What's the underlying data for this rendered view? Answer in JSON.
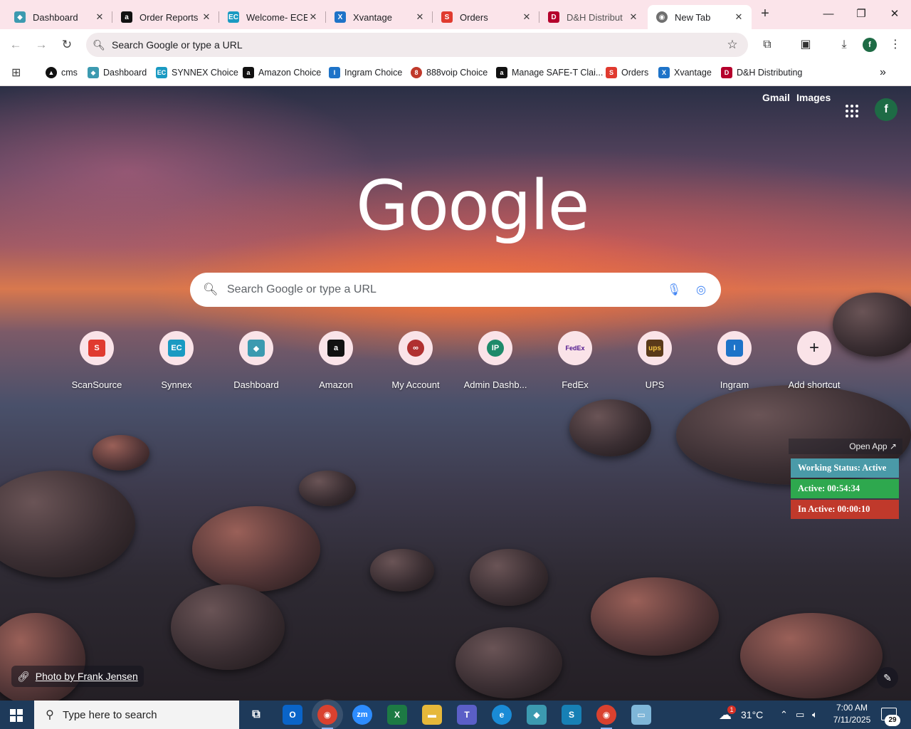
{
  "tabs": [
    {
      "title": "Dashboard",
      "icon": "dashboard-favicon",
      "color": "#3c9ab0"
    },
    {
      "title": "Order Reports",
      "icon": "amazon-favicon",
      "color": "#111111"
    },
    {
      "title": "Welcome- ECE",
      "icon": "ec-favicon",
      "color": "#1a9ac2"
    },
    {
      "title": "Xvantage",
      "icon": "xvantage-favicon",
      "color": "#1e73c8"
    },
    {
      "title": "Orders",
      "icon": "scansource-favicon",
      "color": "#e03a2f"
    },
    {
      "title": "D&H Distribut",
      "icon": "dh-favicon",
      "color": "#b5002c"
    },
    {
      "title": "New Tab",
      "icon": "chrome-favicon",
      "color": "#6f6f6f"
    }
  ],
  "omnibox": {
    "placeholder": "Search Google or type a URL"
  },
  "profile_initial": "f",
  "bookmarks": [
    {
      "label": "cms",
      "icon": "cms-favicon",
      "color": "#111111"
    },
    {
      "label": "Dashboard",
      "icon": "dashboard-favicon",
      "color": "#3c9ab0"
    },
    {
      "label": "SYNNEX Choice",
      "icon": "ec-favicon",
      "color": "#1a9ac2"
    },
    {
      "label": "Amazon Choice",
      "icon": "amazon-favicon",
      "color": "#111111"
    },
    {
      "label": "Ingram Choice",
      "icon": "ingram-favicon",
      "color": "#1e73c8"
    },
    {
      "label": "888voip Choice",
      "icon": "888voip-favicon",
      "color": "#c0392b"
    },
    {
      "label": "Manage SAFE-T Clai...",
      "icon": "amazon-favicon",
      "color": "#111111"
    },
    {
      "label": "Orders",
      "icon": "scansource-favicon",
      "color": "#e03a2f"
    },
    {
      "label": "Xvantage",
      "icon": "xvantage-favicon",
      "color": "#1e73c8"
    },
    {
      "label": "D&H Distributing",
      "icon": "dh-favicon",
      "color": "#b5002c"
    }
  ],
  "google": {
    "links": {
      "gmail": "Gmail",
      "images": "Images"
    },
    "avatar_initial": "f",
    "logo": "Google",
    "search_placeholder": "Search Google or type a URL"
  },
  "shortcuts": [
    {
      "label": "ScanSource",
      "icon": "scansource-icon",
      "glyph": "S",
      "color": "#e03a2f"
    },
    {
      "label": "Synnex",
      "icon": "ec-icon",
      "glyph": "EC",
      "color": "#1a9ac2"
    },
    {
      "label": "Dashboard",
      "icon": "dashboard-icon",
      "glyph": "◆",
      "color": "#3c9ab0"
    },
    {
      "label": "Amazon",
      "icon": "amazon-icon",
      "glyph": "a",
      "color": "#111111"
    },
    {
      "label": "My Account",
      "icon": "my-account-icon",
      "glyph": "∞",
      "color": "#b03030"
    },
    {
      "label": "Admin Dashb...",
      "icon": "ip-icon",
      "glyph": "IP",
      "color": "#1e8a6a"
    },
    {
      "label": "FedEx",
      "icon": "fedex-icon",
      "glyph": "FedEx",
      "color": "#4d148c"
    },
    {
      "label": "UPS",
      "icon": "ups-icon",
      "glyph": "ups",
      "color": "#5a3a1a"
    },
    {
      "label": "Ingram",
      "icon": "ingram-icon",
      "glyph": "I",
      "color": "#1e73c8"
    },
    {
      "label": "Add shortcut",
      "icon": "plus-icon",
      "glyph": "+",
      "color": "#202124"
    }
  ],
  "tracker": {
    "open_app": "Open App ↗",
    "working_status": "Working Status: Active",
    "active": "Active: 00:54:34",
    "inactive": "In Active: 00:00:10",
    "colors": {
      "status": "#4a9aa8",
      "active": "#2ea84e",
      "inactive": "#c0392b"
    }
  },
  "photo_credit": "Photo by Frank Jensen",
  "taskbar": {
    "search_placeholder": "Type here to search",
    "weather": "31°C",
    "weather_badge": "1",
    "time": "7:00 AM",
    "date": "7/11/2025",
    "notifications": "29",
    "apps": [
      {
        "name": "task-view-icon",
        "glyph": "⧉",
        "color": "transparent"
      },
      {
        "name": "outlook-icon",
        "glyph": "O",
        "color": "#0a64c8"
      },
      {
        "name": "chrome-icon",
        "glyph": "◉",
        "color": "#d9412f"
      },
      {
        "name": "zoom-icon",
        "glyph": "zm",
        "color": "#2d8cff"
      },
      {
        "name": "excel-icon",
        "glyph": "X",
        "color": "#1d7a44"
      },
      {
        "name": "file-explorer-icon",
        "glyph": "▬",
        "color": "#e6b83a"
      },
      {
        "name": "teams-icon",
        "glyph": "T",
        "color": "#5b5fc7"
      },
      {
        "name": "edge-icon",
        "glyph": "e",
        "color": "#1a8bd6"
      },
      {
        "name": "dashboard-app-icon",
        "glyph": "◆",
        "color": "#3c9ab0"
      },
      {
        "name": "scansource-app-icon",
        "glyph": "S",
        "color": "#1780b5"
      },
      {
        "name": "chrome-profile-icon",
        "glyph": "◉",
        "color": "#d9412f"
      },
      {
        "name": "notepad-icon",
        "glyph": "▭",
        "color": "#7fb6d8"
      }
    ]
  }
}
